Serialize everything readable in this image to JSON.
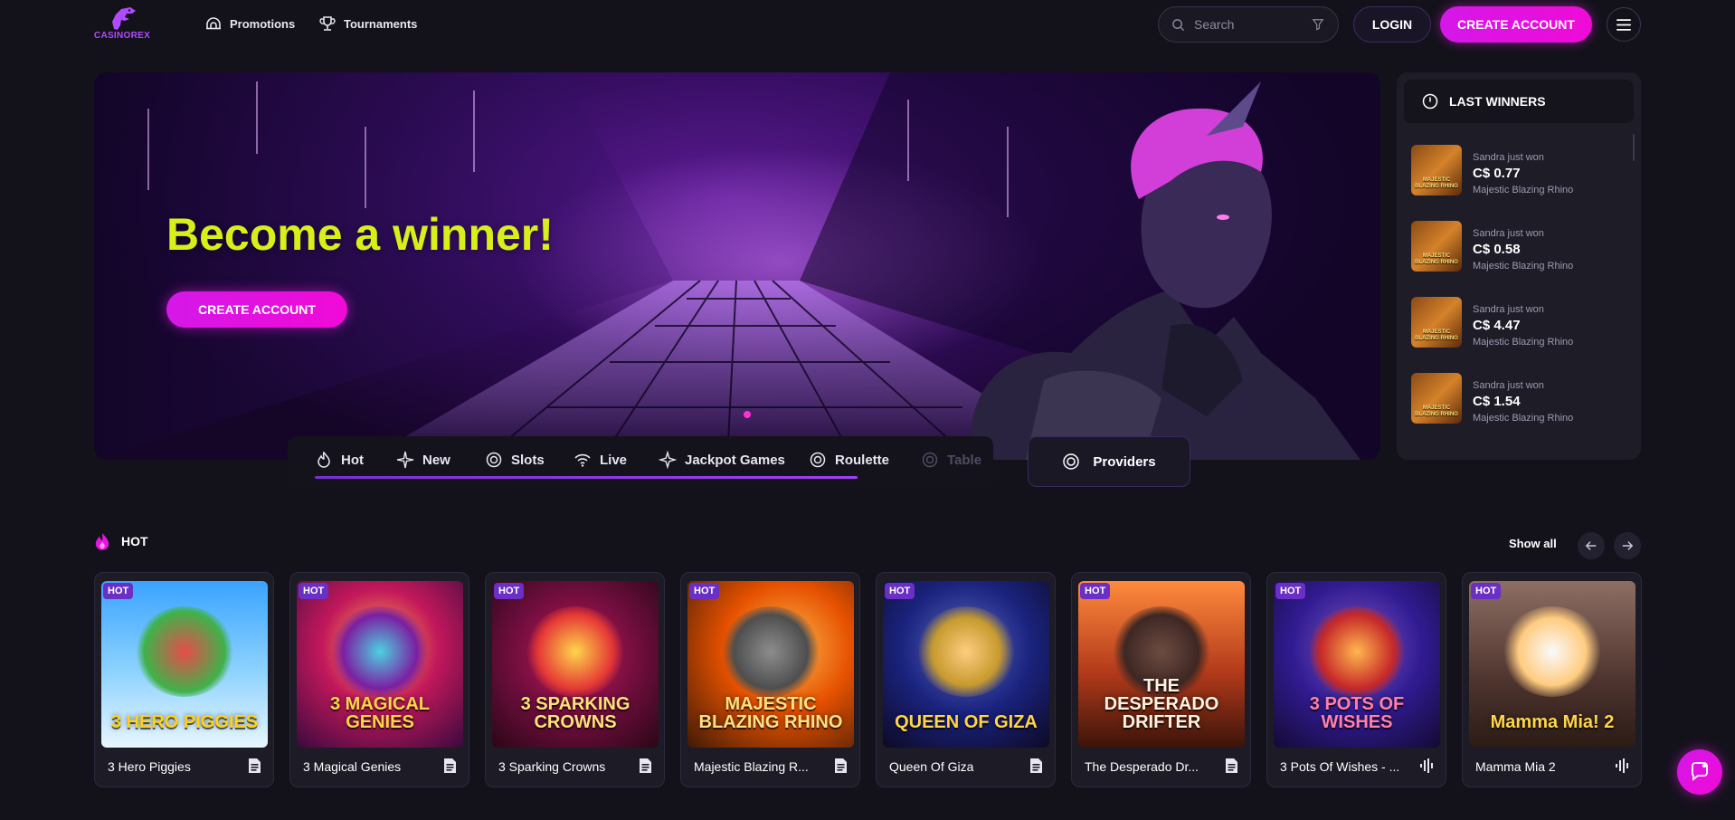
{
  "header": {
    "logo_text": "CASINOREX",
    "nav": [
      {
        "label": "Promotions",
        "icon": "umbrella-icon"
      },
      {
        "label": "Tournaments",
        "icon": "trophy-icon"
      }
    ],
    "search_placeholder": "Search",
    "login_label": "LOGIN",
    "create_account_label": "CREATE ACCOUNT"
  },
  "hero": {
    "title": "Become a winner!",
    "cta_label": "CREATE ACCOUNT",
    "title_color": "#d7f01a"
  },
  "last_winners": {
    "title": "LAST WINNERS",
    "items": [
      {
        "who": "Sandra just won",
        "amount": "C$ 0.77",
        "game": "Majestic Blazing Rhino"
      },
      {
        "who": "Sandra just won",
        "amount": "C$ 0.58",
        "game": "Majestic Blazing Rhino"
      },
      {
        "who": "Sandra just won",
        "amount": "C$ 4.47",
        "game": "Majestic Blazing Rhino"
      },
      {
        "who": "Sandra just won",
        "amount": "C$ 1.54",
        "game": "Majestic Blazing Rhino"
      }
    ]
  },
  "categories": {
    "tabs": [
      {
        "label": "Hot",
        "icon": "flame-icon"
      },
      {
        "label": "New",
        "icon": "sparkle-icon"
      },
      {
        "label": "Slots",
        "icon": "spiral-icon"
      },
      {
        "label": "Live",
        "icon": "wifi-icon"
      },
      {
        "label": "Jackpot Games",
        "icon": "star-icon"
      },
      {
        "label": "Roulette",
        "icon": "spiral-icon"
      },
      {
        "label": "Table",
        "icon": "spiral-icon"
      }
    ],
    "providers_label": "Providers"
  },
  "hot_section": {
    "title": "HOT",
    "show_all_label": "Show all",
    "badge": "HOT",
    "games": [
      {
        "name": "3 Hero Piggies",
        "art_title": "3 HERO PIGGIES",
        "provider_icon": "provider-doc-icon"
      },
      {
        "name": "3 Magical Genies",
        "art_title": "3 MAGICAL GENIES",
        "provider_icon": "provider-doc-icon"
      },
      {
        "name": "3 Sparking Crowns",
        "art_title": "3 SPARKING CROWNS",
        "provider_icon": "provider-doc-icon"
      },
      {
        "name": "Majestic Blazing R...",
        "art_title": "MAJESTIC BLAZING RHINO",
        "provider_icon": "provider-doc-icon"
      },
      {
        "name": "Queen Of Giza",
        "art_title": "QUEEN OF GIZA",
        "provider_icon": "provider-doc-icon"
      },
      {
        "name": "The Desperado Dr...",
        "art_title": "THE DESPERADO DRIFTER",
        "provider_icon": "provider-doc-icon"
      },
      {
        "name": "3 Pots Of Wishes - ...",
        "art_title": "3 POTS OF WISHES",
        "provider_icon": "provider-wave-icon"
      },
      {
        "name": "Mamma Mia 2",
        "art_title": "Mamma Mia! 2",
        "provider_icon": "provider-wave-icon"
      }
    ]
  },
  "colors": {
    "accent": "#e814e0",
    "background": "#13121b",
    "badge": "#6a2fc4"
  }
}
